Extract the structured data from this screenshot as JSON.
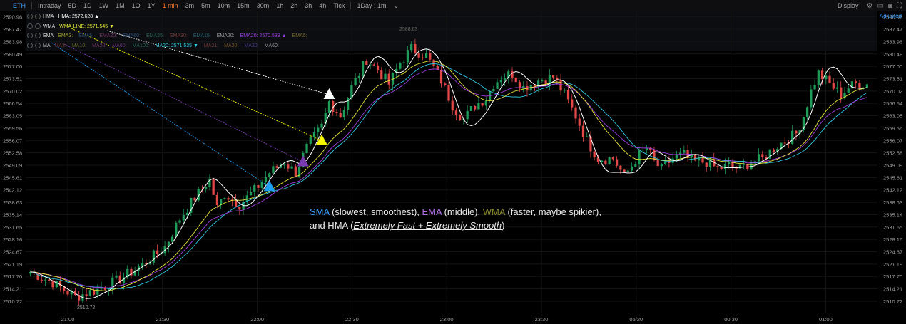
{
  "toolbar": {
    "symbol": "ETH",
    "items": [
      "Intraday",
      "5D",
      "1D",
      "1W",
      "1M",
      "1Q",
      "1Y",
      "1 min",
      "3m",
      "5m",
      "10m",
      "15m",
      "30m",
      "1h",
      "2h",
      "3h",
      "4h",
      "Tick"
    ],
    "active": "1 min",
    "interval_dropdown": "1Day : 1m",
    "display_label": "Display",
    "adjusted_label": "Adjusted"
  },
  "indicators": {
    "hma": {
      "name": "HMA",
      "items": [
        {
          "label": "HMA: 2572.628 ▲",
          "color": "#ffffff"
        }
      ]
    },
    "wma": {
      "name": "WMA",
      "items": [
        {
          "label": "WMA-LINE: 2571.545 ▼",
          "color": "#e6e63c"
        }
      ]
    },
    "ema": {
      "name": "EMA",
      "items": [
        {
          "label": "EMA3:",
          "color": "#a0a030"
        },
        {
          "label": "EMA5:",
          "color": "#2a4e7a"
        },
        {
          "label": "EMA20:",
          "color": "#7a3a6a"
        },
        {
          "label": "EMA60:",
          "color": "#2a4e7a"
        },
        {
          "label": "EMA25:",
          "color": "#2a6a5a"
        },
        {
          "label": "EMA30:",
          "color": "#7a3a3a"
        },
        {
          "label": "EMA15:",
          "color": "#2a6a7a"
        },
        {
          "label": "EMA20:",
          "color": "#9a9a9a"
        },
        {
          "label": "EMA20: 2570.539 ▲",
          "color": "#a040e0"
        },
        {
          "label": "EMA5:",
          "color": "#7a6a2a"
        }
      ]
    },
    "ma": {
      "name": "MA",
      "items": [
        {
          "label": "MA3:",
          "color": "#7a3a3a"
        },
        {
          "label": "MA10:",
          "color": "#6a6a2a"
        },
        {
          "label": "MA20:",
          "color": "#7a3a6a"
        },
        {
          "label": "MA60:",
          "color": "#6a3a7a"
        },
        {
          "label": "MA100:",
          "color": "#2a6a5a"
        },
        {
          "label": "MA20: 2571.535 ▼",
          "color": "#30c8e0"
        },
        {
          "label": "MA21:",
          "color": "#7a3a3a"
        },
        {
          "label": "MA20:",
          "color": "#7a5a2a"
        },
        {
          "label": "MA30:",
          "color": "#4a3a8a"
        },
        {
          "label": "MA60:",
          "color": "#9a9a9a"
        }
      ]
    }
  },
  "annotation": {
    "line1": [
      {
        "text": "SMA",
        "color": "#3aa0ff"
      },
      {
        "text": " (slowest, smoothest), ",
        "color": "#e8e8e8"
      },
      {
        "text": "EMA",
        "color": "#b070e0"
      },
      {
        "text": " (middle), ",
        "color": "#e8e8e8"
      },
      {
        "text": "WMA",
        "color": "#8a8a30"
      },
      {
        "text": " (faster, maybe spikier),",
        "color": "#e8e8e8"
      }
    ],
    "line2_prefix": "and HMA (",
    "line2_em": "Extremely Fast + Extremely Smooth",
    "line2_suffix": ")"
  },
  "chart_data": {
    "type": "candlestick",
    "title": "ETH",
    "ylim": [
      2508.5,
      2592.5
    ],
    "y_ticks": [
      2590.96,
      2587.47,
      2583.98,
      2580.49,
      2577.0,
      2573.51,
      2570.02,
      2566.54,
      2563.05,
      2559.56,
      2556.07,
      2552.58,
      2549.09,
      2545.61,
      2542.12,
      2538.63,
      2535.14,
      2531.65,
      2528.16,
      2524.67,
      2521.19,
      2517.7,
      2514.21,
      2510.72
    ],
    "x_ticks": [
      "21:00",
      "21:30",
      "22:00",
      "22:30",
      "23:00",
      "23:30",
      "05/20",
      "00:30",
      "01:00"
    ],
    "high_label": "2588.63",
    "low_label": "2510.72",
    "close_path": [
      [
        0,
        2519
      ],
      [
        6,
        2516
      ],
      [
        12,
        2512
      ],
      [
        18,
        2514
      ],
      [
        24,
        2517
      ],
      [
        30,
        2521
      ],
      [
        36,
        2526
      ],
      [
        40,
        2534
      ],
      [
        44,
        2540
      ],
      [
        48,
        2545
      ],
      [
        50,
        2537
      ],
      [
        52,
        2541
      ],
      [
        56,
        2538
      ],
      [
        60,
        2542
      ],
      [
        64,
        2547
      ],
      [
        68,
        2550
      ],
      [
        71,
        2547
      ],
      [
        74,
        2554
      ],
      [
        78,
        2560
      ],
      [
        80,
        2567
      ],
      [
        83,
        2563
      ],
      [
        86,
        2571
      ],
      [
        90,
        2579
      ],
      [
        93,
        2576
      ],
      [
        96,
        2572
      ],
      [
        99,
        2578
      ],
      [
        102,
        2582
      ],
      [
        106,
        2580
      ],
      [
        110,
        2573
      ],
      [
        113,
        2566
      ],
      [
        116,
        2562
      ],
      [
        119,
        2566
      ],
      [
        122,
        2568
      ],
      [
        124,
        2572
      ],
      [
        126,
        2574
      ],
      [
        129,
        2575
      ],
      [
        132,
        2571
      ],
      [
        136,
        2573
      ],
      [
        140,
        2574
      ],
      [
        143,
        2569
      ],
      [
        146,
        2563
      ],
      [
        149,
        2556
      ],
      [
        152,
        2551
      ],
      [
        156,
        2551
      ],
      [
        159,
        2546
      ],
      [
        161,
        2549
      ],
      [
        163,
        2552
      ],
      [
        165,
        2554
      ],
      [
        167,
        2550
      ],
      [
        169,
        2548
      ],
      [
        172,
        2551
      ],
      [
        175,
        2552
      ],
      [
        178,
        2550
      ],
      [
        181,
        2550
      ],
      [
        184,
        2548
      ],
      [
        187,
        2549
      ],
      [
        190,
        2548
      ],
      [
        193,
        2550
      ],
      [
        196,
        2551
      ],
      [
        199,
        2554
      ],
      [
        202,
        2556
      ],
      [
        205,
        2558
      ],
      [
        207,
        2563
      ],
      [
        209,
        2570
      ],
      [
        211,
        2575
      ],
      [
        213,
        2573
      ],
      [
        215,
        2571
      ],
      [
        217,
        2569
      ],
      [
        219,
        2571
      ],
      [
        221,
        2572
      ],
      [
        223,
        2572
      ]
    ],
    "series": [
      {
        "name": "HMA",
        "color": "#ffffff"
      },
      {
        "name": "WMA",
        "color": "#e6e63c"
      },
      {
        "name": "EMA",
        "color": "#a040e0"
      },
      {
        "name": "SMA",
        "color": "#30c8e0"
      }
    ],
    "markers": [
      {
        "series": "SMA",
        "color": "#1e9ff2",
        "x": 64,
        "y": 2543
      },
      {
        "series": "EMA",
        "color": "#7a3ab0",
        "x": 73,
        "y": 2550
      },
      {
        "series": "WMA",
        "color": "#f5f500",
        "x": 78,
        "y": 2556
      },
      {
        "series": "HMA",
        "color": "#ffffff",
        "x": 80,
        "y": 2569
      }
    ]
  }
}
